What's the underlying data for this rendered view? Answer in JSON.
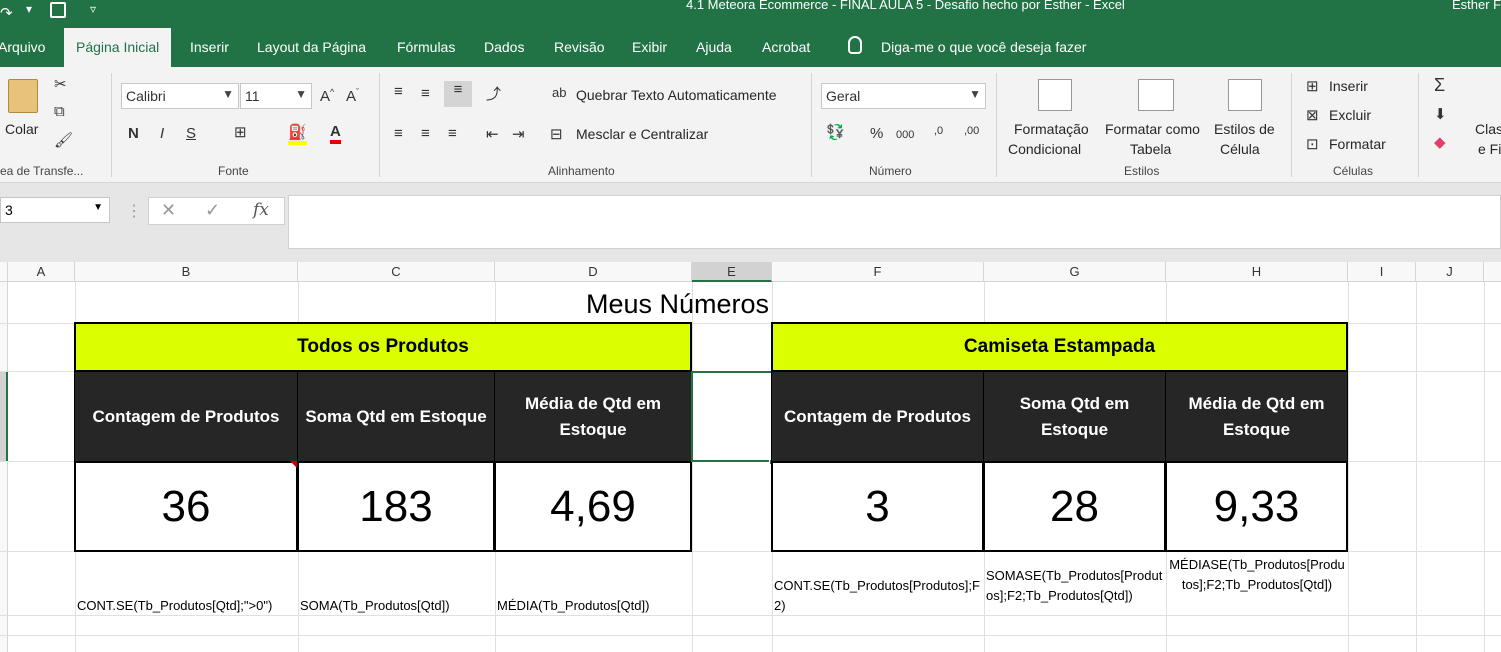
{
  "window": {
    "title": "4.1 Meteora Ecommerce - FINAL AULA 5 - Desafio hecho por Esther  -  Excel",
    "user": "Esther F"
  },
  "ribbon_tabs": [
    "Arquivo",
    "Página Inicial",
    "Inserir",
    "Layout da Página",
    "Fórmulas",
    "Dados",
    "Revisão",
    "Exibir",
    "Ajuda",
    "Acrobat"
  ],
  "tell_me": "Diga-me o que você deseja fazer",
  "ribbon": {
    "paste_label": "Colar",
    "clipboard_group": "ea de Transfe...",
    "font_name": "Calibri",
    "font_size": "11",
    "font_group": "Fonte",
    "wrap_text": "Quebrar Texto Automaticamente",
    "merge_center": "Mesclar e Centralizar",
    "alignment_group": "Alinhamento",
    "number_format": "Geral",
    "number_group": "Número",
    "cond_format_l1": "Formatação",
    "cond_format_l2": "Condicional",
    "format_table_l1": "Formatar como",
    "format_table_l2": "Tabela",
    "cell_styles_l1": "Estilos de",
    "cell_styles_l2": "Célula",
    "styles_group": "Estilos",
    "insert": "Inserir",
    "delete": "Excluir",
    "format": "Formatar",
    "cells_group": "Células",
    "sort_l1": "Clas",
    "sort_l2": "e Fi"
  },
  "name_box": "3",
  "formula_bar": "",
  "columns": [
    "A",
    "B",
    "C",
    "D",
    "E",
    "F",
    "G",
    "H",
    "I",
    "J"
  ],
  "sheet": {
    "title": "Meus Números",
    "left_block": {
      "header": "Todos os Produtos",
      "col_labels": [
        "Contagem de Produtos",
        "Soma Qtd em Estoque",
        "Média de Qtd em Estoque"
      ],
      "values": [
        "36",
        "183",
        "4,69"
      ],
      "formulas": [
        "CONT.SE(Tb_Produtos[Qtd];\">0\")",
        "SOMA(Tb_Produtos[Qtd])",
        "MÉDIA(Tb_Produtos[Qtd])"
      ]
    },
    "right_block": {
      "header": "Camiseta Estampada",
      "col_labels": [
        "Contagem de Produtos",
        "Soma Qtd em Estoque",
        "Média de Qtd em Estoque"
      ],
      "values": [
        "3",
        "28",
        "9,33"
      ],
      "formulas": [
        "CONT.SE(Tb_Produtos[Produtos];F2)",
        "SOMASE(Tb_Produtos[Produtos];F2;Tb_Produtos[Qtd])",
        "MÉDIASE(Tb_Produtos[Produtos];F2;Tb_Produtos[Qtd])"
      ]
    }
  },
  "colors": {
    "excel_green": "#217346",
    "header_yellow": "#dcff00",
    "header_dark": "#262626"
  }
}
